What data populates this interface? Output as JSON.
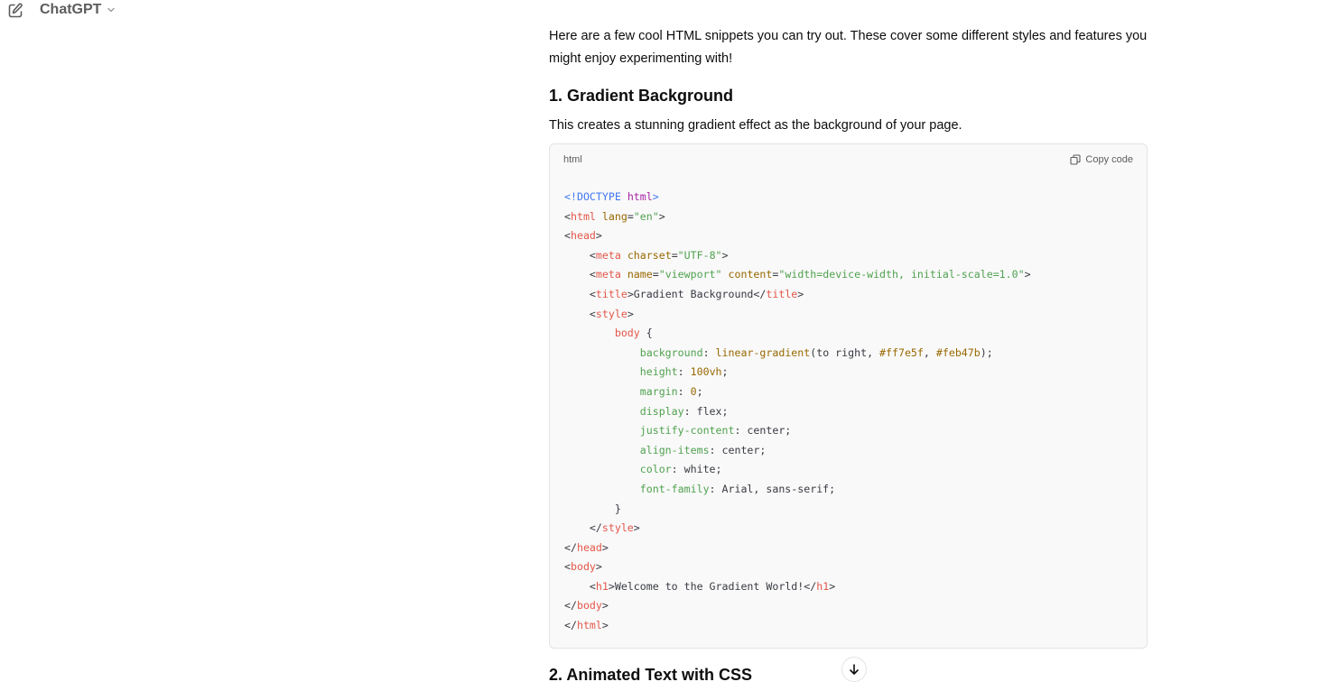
{
  "header": {
    "new_chat_icon": "edit-pencil-icon",
    "model_name": "ChatGPT",
    "model_chevron_icon": "chevron-down-icon"
  },
  "message": {
    "intro": "Here are a few cool HTML snippets you can try out. These cover some different styles and features you might enjoy experimenting with!",
    "section1_title": "1. Gradient Background",
    "section1_desc": "This creates a stunning gradient effect as the background of your page.",
    "code_lang": "html",
    "copy_label": "Copy code",
    "copy_icon": "copy-icon",
    "code_lines": [
      "<!DOCTYPE html>",
      "<html lang=\"en\">",
      "<head>",
      "    <meta charset=\"UTF-8\">",
      "    <meta name=\"viewport\" content=\"width=device-width, initial-scale=1.0\">",
      "    <title>Gradient Background</title>",
      "    <style>",
      "        body {",
      "            background: linear-gradient(to right, #ff7e5f, #feb47b);",
      "            height: 100vh;",
      "            margin: 0;",
      "            display: flex;",
      "            justify-content: center;",
      "            align-items: center;",
      "            color: white;",
      "            font-family: Arial, sans-serif;",
      "        }",
      "    </style>",
      "</head>",
      "<body>",
      "    <h1>Welcome to the Gradient World!</h1>",
      "</body>",
      "</html>"
    ],
    "section2_title": "2. Animated Text with CSS",
    "scroll_icon": "arrow-down-icon"
  }
}
